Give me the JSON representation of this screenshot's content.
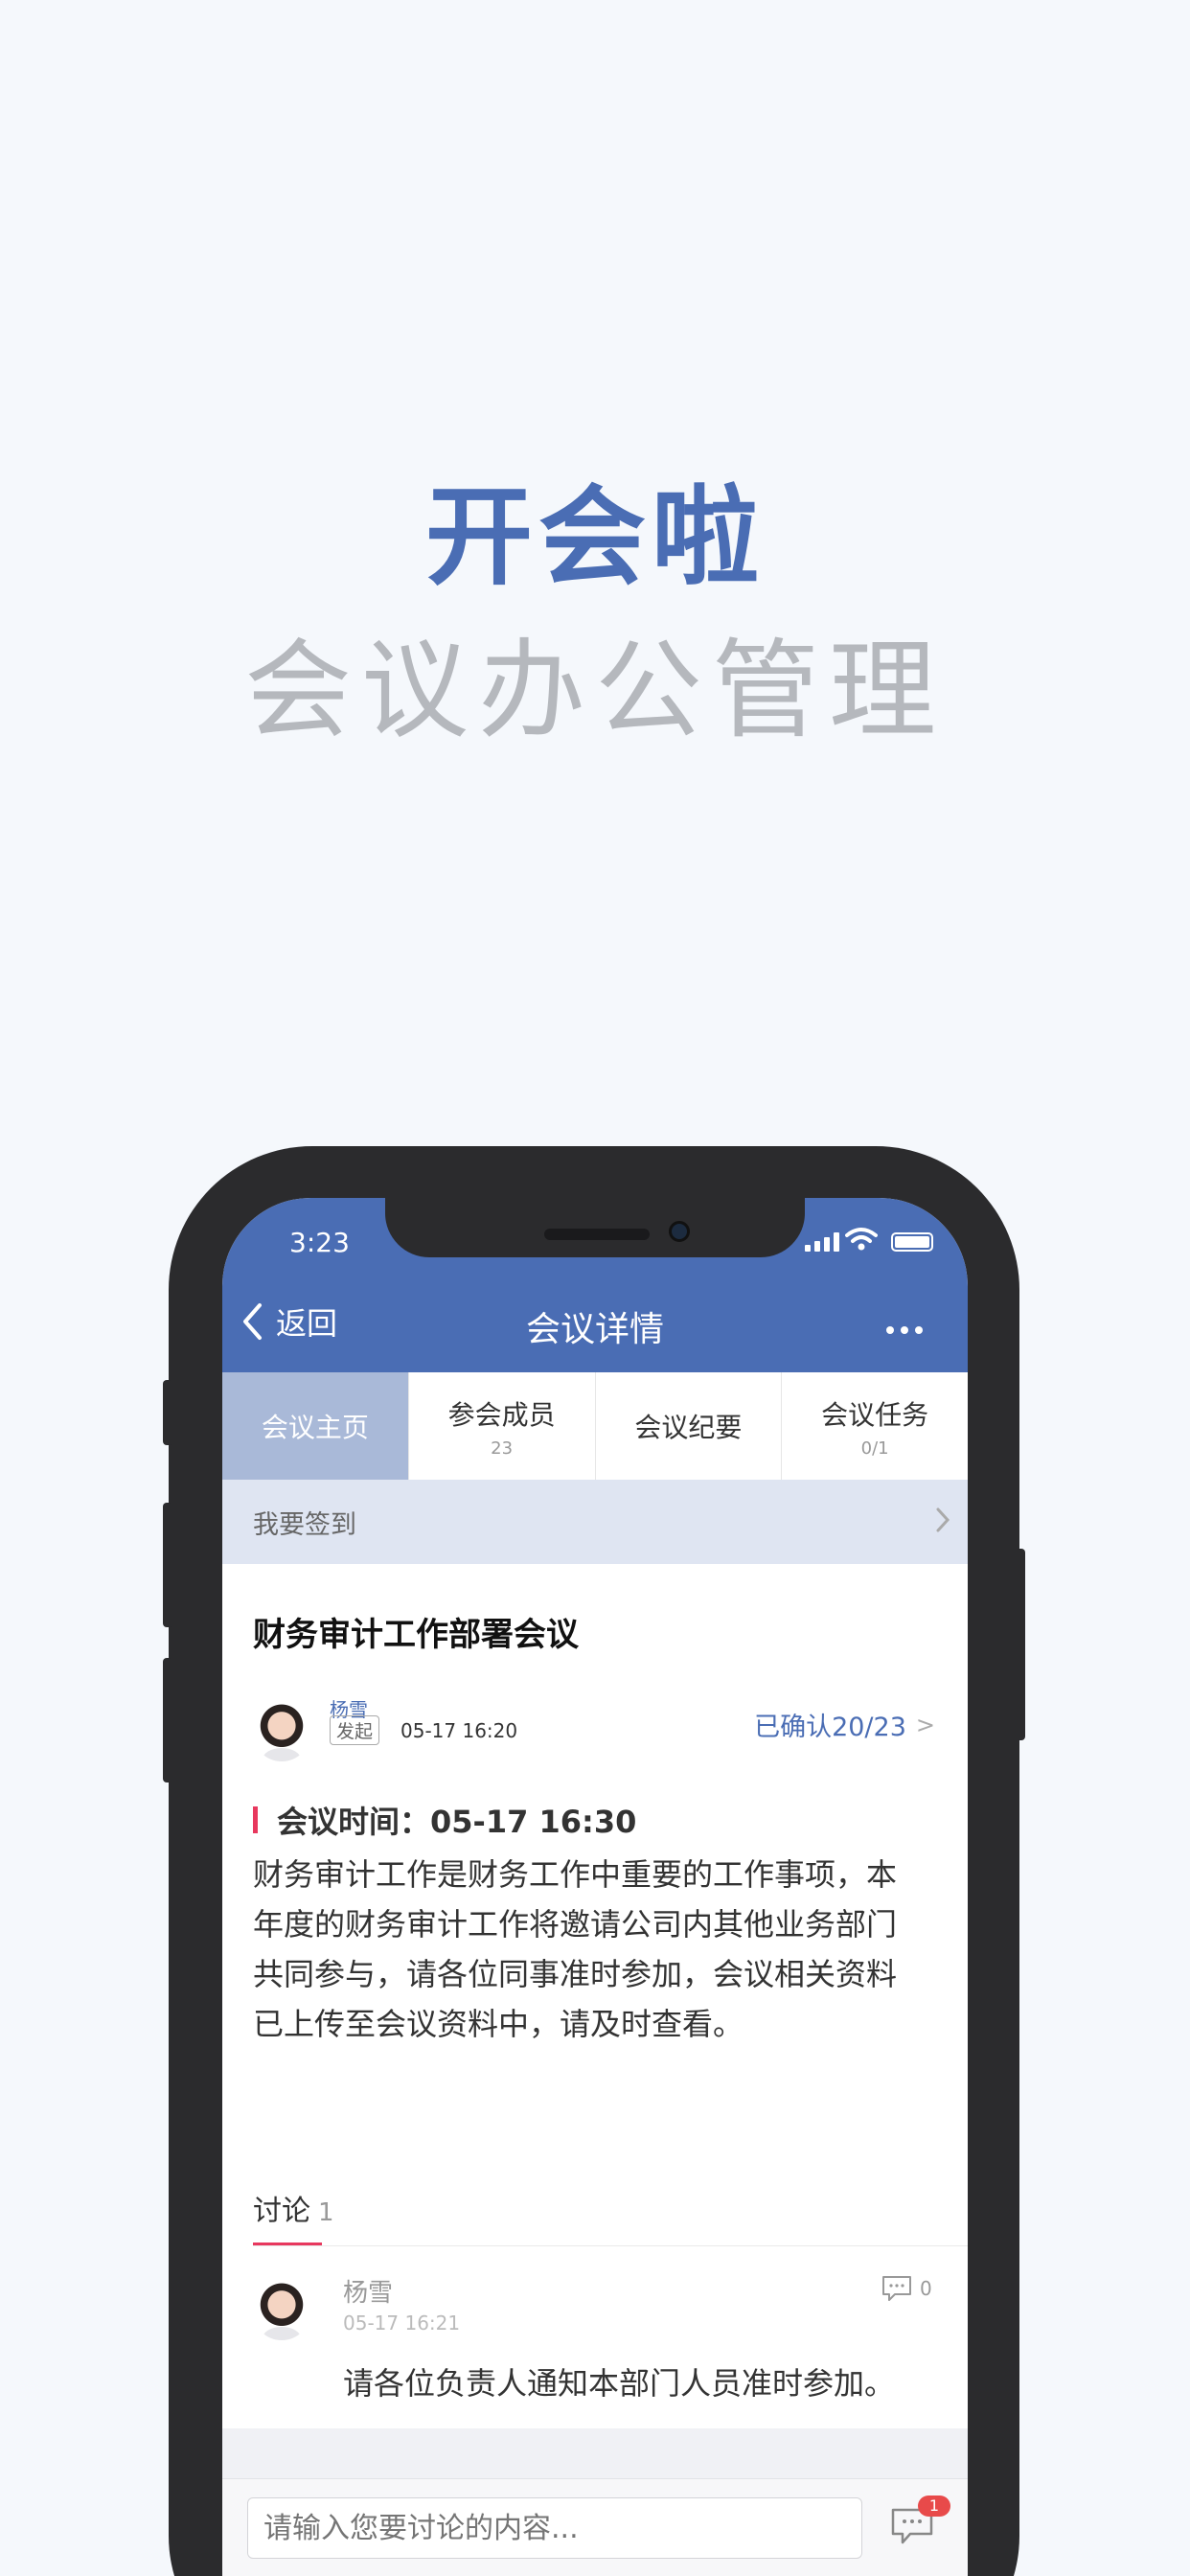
{
  "hero": {
    "title": "开会啦",
    "subtitle": "会议办公管理"
  },
  "status_bar": {
    "time": "3:23"
  },
  "nav": {
    "back_label": "返回",
    "title": "会议详情",
    "more_icon": "more-icon"
  },
  "tabs": [
    {
      "label": "会议主页",
      "count": "",
      "active": true
    },
    {
      "label": "参会成员",
      "count": "23",
      "active": false
    },
    {
      "label": "会议纪要",
      "count": "",
      "active": false
    },
    {
      "label": "会议任务",
      "count": "0/1",
      "active": false
    }
  ],
  "signin": {
    "label": "我要签到"
  },
  "meeting": {
    "title": "财务审计工作部署会议",
    "author": "杨雪",
    "badge": "发起",
    "created": "05-17 16:20",
    "confirmed": "已确认20/23",
    "confirmed_arrow": ">",
    "time_label": "会议时间：05-17 16:30",
    "description": "财务审计工作是财务工作中重要的工作事项，本年度的财务审计工作将邀请公司内其他业务部门共同参与，请各位同事准时参加，会议相关资料已上传至会议资料中，请及时查看。"
  },
  "discussion": {
    "tab_label": "讨论",
    "count": "1",
    "comments": [
      {
        "author": "杨雪",
        "time": "05-17 16:21",
        "replies": "0",
        "text": "请各位负责人通知本部门人员准时参加。"
      }
    ]
  },
  "composer": {
    "placeholder": "请输入您要讨论的内容...",
    "badge": "1"
  },
  "colors": {
    "brand": "#4a6db4",
    "accent": "#e8385e",
    "tab_active": "#a9b9d8",
    "badge": "#e84a4a"
  }
}
